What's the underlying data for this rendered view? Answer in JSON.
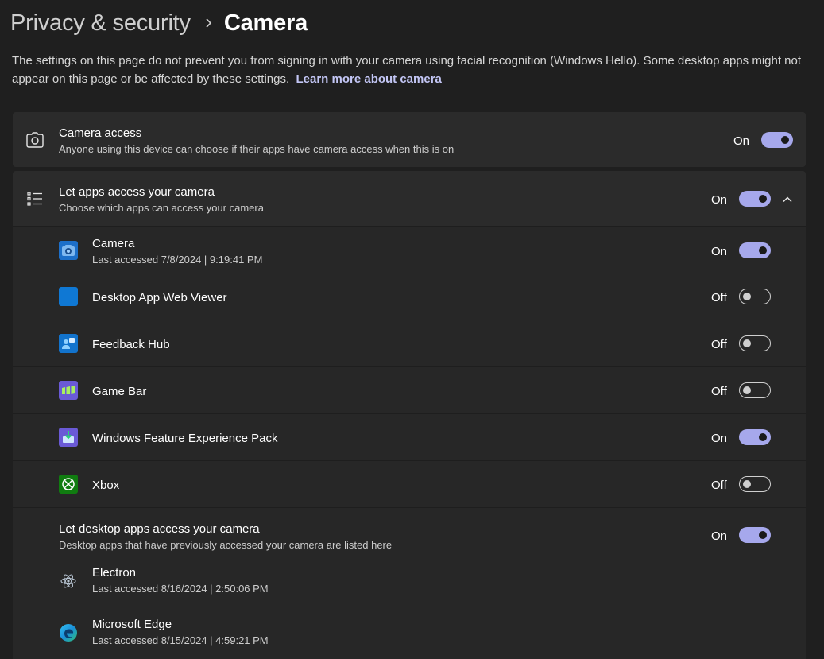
{
  "breadcrumb": {
    "parent": "Privacy & security",
    "current": "Camera"
  },
  "description": {
    "text": "The settings on this page do not prevent you from signing in with your camera using facial recognition (Windows Hello). Some desktop apps might not appear on this page or be affected by these settings.",
    "link": "Learn more about camera"
  },
  "camera_access": {
    "title": "Camera access",
    "subtitle": "Anyone using this device can choose if their apps have camera access when this is on",
    "state": "On",
    "icon": "camera-icon"
  },
  "apps_access": {
    "title": "Let apps access your camera",
    "subtitle": "Choose which apps can access your camera",
    "state": "On",
    "icon": "list-icon"
  },
  "apps": [
    {
      "name": "Camera",
      "detail": "Last accessed 7/8/2024  |  9:19:41 PM",
      "state": "On",
      "icon": "camera-app-icon"
    },
    {
      "name": "Desktop App Web Viewer",
      "detail": "",
      "state": "Off",
      "icon": "web-viewer-icon"
    },
    {
      "name": "Feedback Hub",
      "detail": "",
      "state": "Off",
      "icon": "feedback-hub-icon"
    },
    {
      "name": "Game Bar",
      "detail": "",
      "state": "Off",
      "icon": "game-bar-icon"
    },
    {
      "name": "Windows Feature Experience Pack",
      "detail": "",
      "state": "On",
      "icon": "feature-pack-icon"
    },
    {
      "name": "Xbox",
      "detail": "",
      "state": "Off",
      "icon": "xbox-icon"
    }
  ],
  "desktop_apps": {
    "title": "Let desktop apps access your camera",
    "subtitle": "Desktop apps that have previously accessed your camera are listed here",
    "state": "On",
    "items": [
      {
        "name": "Electron",
        "detail": "Last accessed 8/16/2024  |  2:50:06 PM",
        "icon": "electron-icon"
      },
      {
        "name": "Microsoft Edge",
        "detail": "Last accessed 8/15/2024  |  4:59:21 PM",
        "icon": "edge-icon"
      }
    ]
  },
  "colors": {
    "accent": "#a6a8ec",
    "background": "#1f1f1f",
    "card": "#2b2b2b",
    "link": "#c3c6f5"
  }
}
